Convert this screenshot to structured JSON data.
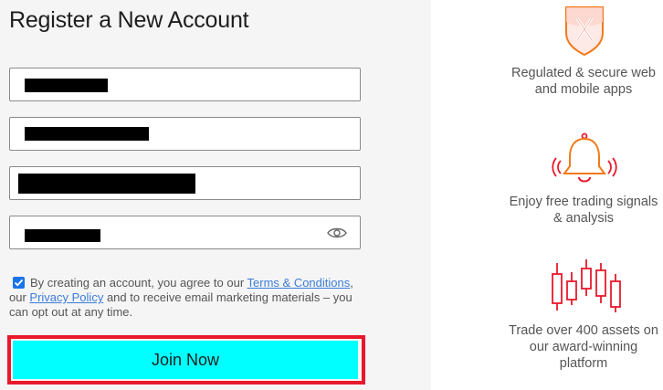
{
  "form": {
    "title": "Register a New Account",
    "consent": {
      "text_before": "By creating an account, you agree to our ",
      "terms_link": "Terms & Conditions",
      "text_middle": ", our ",
      "privacy_link": "Privacy Policy",
      "text_after": " and to receive email marketing materials – you can opt out at any time.",
      "checked": true
    },
    "join_label": "Join Now"
  },
  "features": [
    {
      "icon": "shield-x-icon",
      "text": "Regulated & secure web and mobile apps"
    },
    {
      "icon": "bell-icon",
      "text": "Enjoy free trading signals & analysis"
    },
    {
      "icon": "candlestick-icon",
      "text": "Trade over 400 assets on our award-winning platform"
    }
  ],
  "colors": {
    "accent": "#e8192c",
    "icon_orange": "#f27a1a",
    "button_bg": "#00ffff",
    "link": "#3b7dd8",
    "checkbox": "#1a73e8"
  }
}
